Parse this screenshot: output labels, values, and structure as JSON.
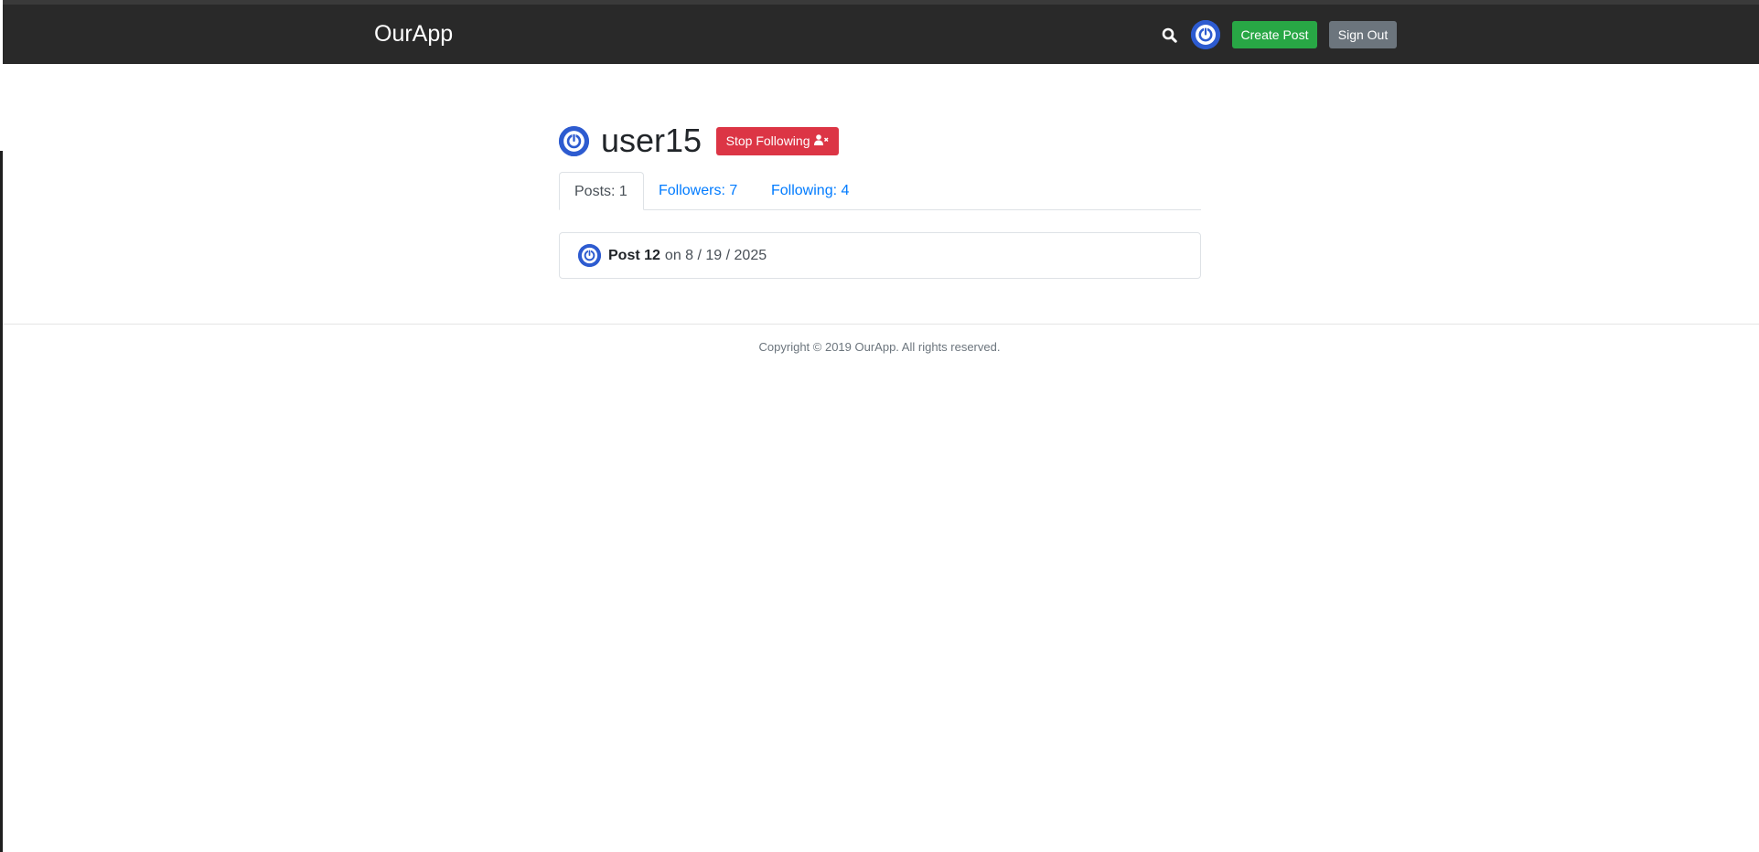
{
  "header": {
    "brand": "OurApp",
    "create_post_label": "Create Post",
    "sign_out_label": "Sign Out"
  },
  "profile": {
    "username": "user15",
    "stop_following_label": "Stop Following"
  },
  "tabs": [
    {
      "label": "Posts: 1",
      "active": true
    },
    {
      "label": "Followers: 7",
      "active": false
    },
    {
      "label": "Following: 4",
      "active": false
    }
  ],
  "posts": [
    {
      "title": "Post 12",
      "date": "on 8 / 19 / 2025"
    }
  ],
  "footer": {
    "copyright": "Copyright © 2019 OurApp. All rights reserved."
  },
  "colors": {
    "header_bg": "#292929",
    "create_post": "#28a745",
    "sign_out": "#6c757d",
    "stop_following": "#dc3545",
    "link": "#007bff",
    "avatar": "#2d5bd0"
  },
  "icons": {
    "search": "search-icon",
    "avatar": "power-avatar-icon",
    "unfollow": "user-times-icon"
  }
}
